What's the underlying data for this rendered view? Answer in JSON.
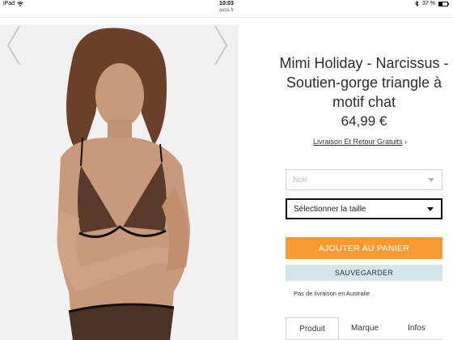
{
  "status_bar": {
    "device": "iPad",
    "time": "10:03",
    "battery": "37 %",
    "battery_level": 0.37,
    "url": "asos.fr"
  },
  "product": {
    "title": "Mimi Holiday - Narcissus - Soutien-gorge triangle à motif chat",
    "price": "64,99 €",
    "shipping_link": "Livraison Et Retour Gratuits",
    "shipping_chevron": "›"
  },
  "options": {
    "color_select": {
      "value": "Noir"
    },
    "size_select": {
      "value": "Sélectionner la taille"
    }
  },
  "actions": {
    "add_to_cart": "AJOUTER AU PANIER",
    "save": "SAUVEGARDER"
  },
  "delivery_note": "Pas de livraison en Australie",
  "tabs": [
    {
      "label": "Produit",
      "active": true
    },
    {
      "label": "Marque",
      "active": false
    },
    {
      "label": "Infos",
      "active": false
    }
  ],
  "icons": {
    "wifi": "wifi-icon",
    "bluetooth": "bluetooth-icon",
    "battery": "battery-icon",
    "prev": "chevron-left-icon",
    "next": "chevron-right-icon"
  },
  "colors": {
    "add_to_cart_bg": "#f99932",
    "save_bg": "#d3e7ea",
    "image_bg": "#f1f1f1"
  }
}
